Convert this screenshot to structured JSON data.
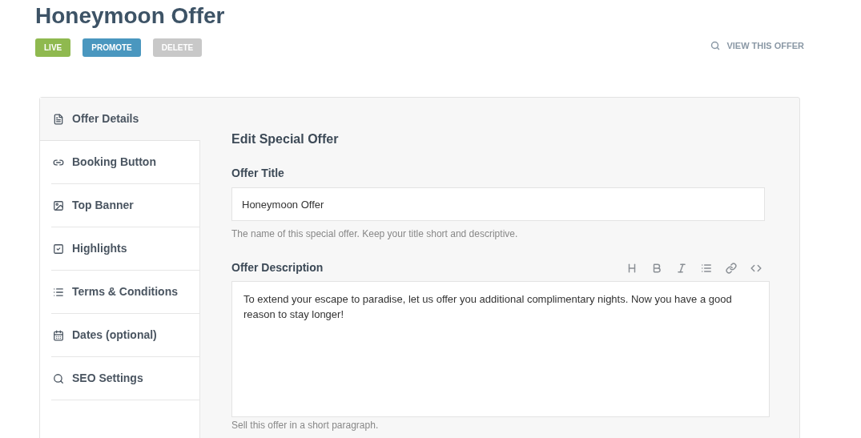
{
  "page_title": "Honeymoon Offer",
  "actions": [
    {
      "label": "LIVE",
      "color": "#8fb94f"
    },
    {
      "label": "PROMOTE",
      "color": "#4a97bf"
    },
    {
      "label": "DELETE",
      "color": "#c8c8c8"
    }
  ],
  "view_link": "VIEW THIS OFFER",
  "sidebar": {
    "items": [
      {
        "label": "Offer Details",
        "selected": true
      },
      {
        "label": "Booking Button",
        "selected": false
      },
      {
        "label": "Top Banner",
        "selected": false
      },
      {
        "label": "Highlights",
        "selected": false
      },
      {
        "label": "Terms & Conditions",
        "selected": false
      },
      {
        "label": "Dates (optional)",
        "selected": false
      },
      {
        "label": "SEO Settings",
        "selected": false
      }
    ]
  },
  "form": {
    "heading": "Edit Special Offer",
    "title_field": {
      "label": "Offer Title",
      "value": "Honeymoon Offer",
      "help": "The name of this special offer. Keep your title short and descriptive."
    },
    "description_field": {
      "label": "Offer Description",
      "value": "To extend your escape to paradise, let us offer you additional complimentary nights. Now you have a good reason to stay longer!",
      "help": "Sell this offer in a short paragraph."
    }
  }
}
